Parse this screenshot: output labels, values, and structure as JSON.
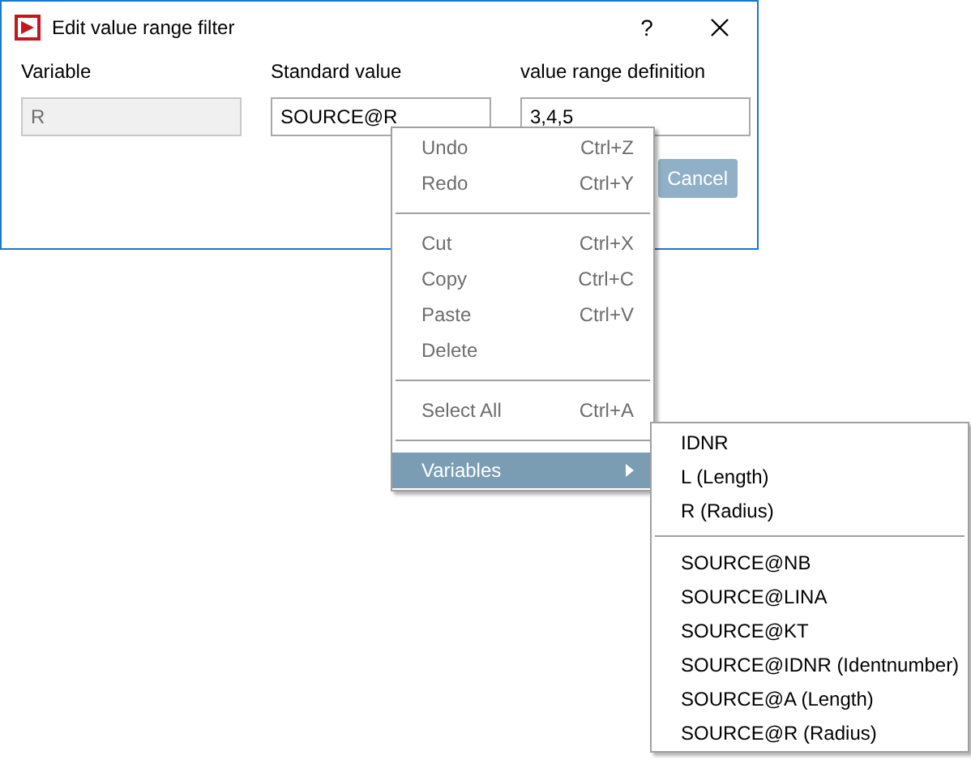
{
  "window": {
    "title": "Edit value range filter",
    "help": "?"
  },
  "fields": [
    {
      "label": "Variable",
      "value": "R",
      "disabled": true
    },
    {
      "label": "Standard value",
      "value": "SOURCE@R",
      "disabled": false
    },
    {
      "label": "value range definition",
      "value": "3,4,5",
      "disabled": false
    }
  ],
  "buttons": [
    {
      "label": "Cancel",
      "disabled": true
    }
  ],
  "context_menu": [
    {
      "kind": "item",
      "label": "Undo",
      "shortcut": "Ctrl+Z",
      "disabled": true,
      "selected": false
    },
    {
      "kind": "item",
      "label": "Redo",
      "shortcut": "Ctrl+Y",
      "disabled": true,
      "selected": false
    },
    {
      "kind": "separator"
    },
    {
      "kind": "item",
      "label": "Cut",
      "shortcut": "Ctrl+X",
      "disabled": true,
      "selected": false
    },
    {
      "kind": "item",
      "label": "Copy",
      "shortcut": "Ctrl+C",
      "disabled": true,
      "selected": false
    },
    {
      "kind": "item",
      "label": "Paste",
      "shortcut": "Ctrl+V",
      "disabled": true,
      "selected": false
    },
    {
      "kind": "item",
      "label": "Delete",
      "disabled": true,
      "selected": false
    },
    {
      "kind": "separator"
    },
    {
      "kind": "item",
      "label": "Select All",
      "shortcut": "Ctrl+A",
      "disabled": true,
      "selected": false
    },
    {
      "kind": "separator"
    },
    {
      "kind": "submenu",
      "label": "Variables",
      "disabled": false,
      "selected": true
    }
  ],
  "submenu": [
    {
      "kind": "item",
      "label": "IDNR",
      "disabled": false,
      "selected": false
    },
    {
      "kind": "item",
      "label": "L (Length)",
      "disabled": false,
      "selected": false
    },
    {
      "kind": "item",
      "label": "R (Radius)",
      "disabled": false,
      "selected": false
    },
    {
      "kind": "separator"
    },
    {
      "kind": "item",
      "label": "SOURCE@NB",
      "disabled": false,
      "selected": false
    },
    {
      "kind": "item",
      "label": "SOURCE@LINA",
      "disabled": false,
      "selected": false
    },
    {
      "kind": "item",
      "label": "SOURCE@KT",
      "disabled": false,
      "selected": false
    },
    {
      "kind": "item",
      "label": "SOURCE@IDNR (Identnumber)",
      "disabled": false,
      "selected": false
    },
    {
      "kind": "item",
      "label": "SOURCE@A (Length)",
      "disabled": false,
      "selected": false
    },
    {
      "kind": "item",
      "label": "SOURCE@R (Radius)",
      "disabled": false,
      "selected": false
    }
  ]
}
